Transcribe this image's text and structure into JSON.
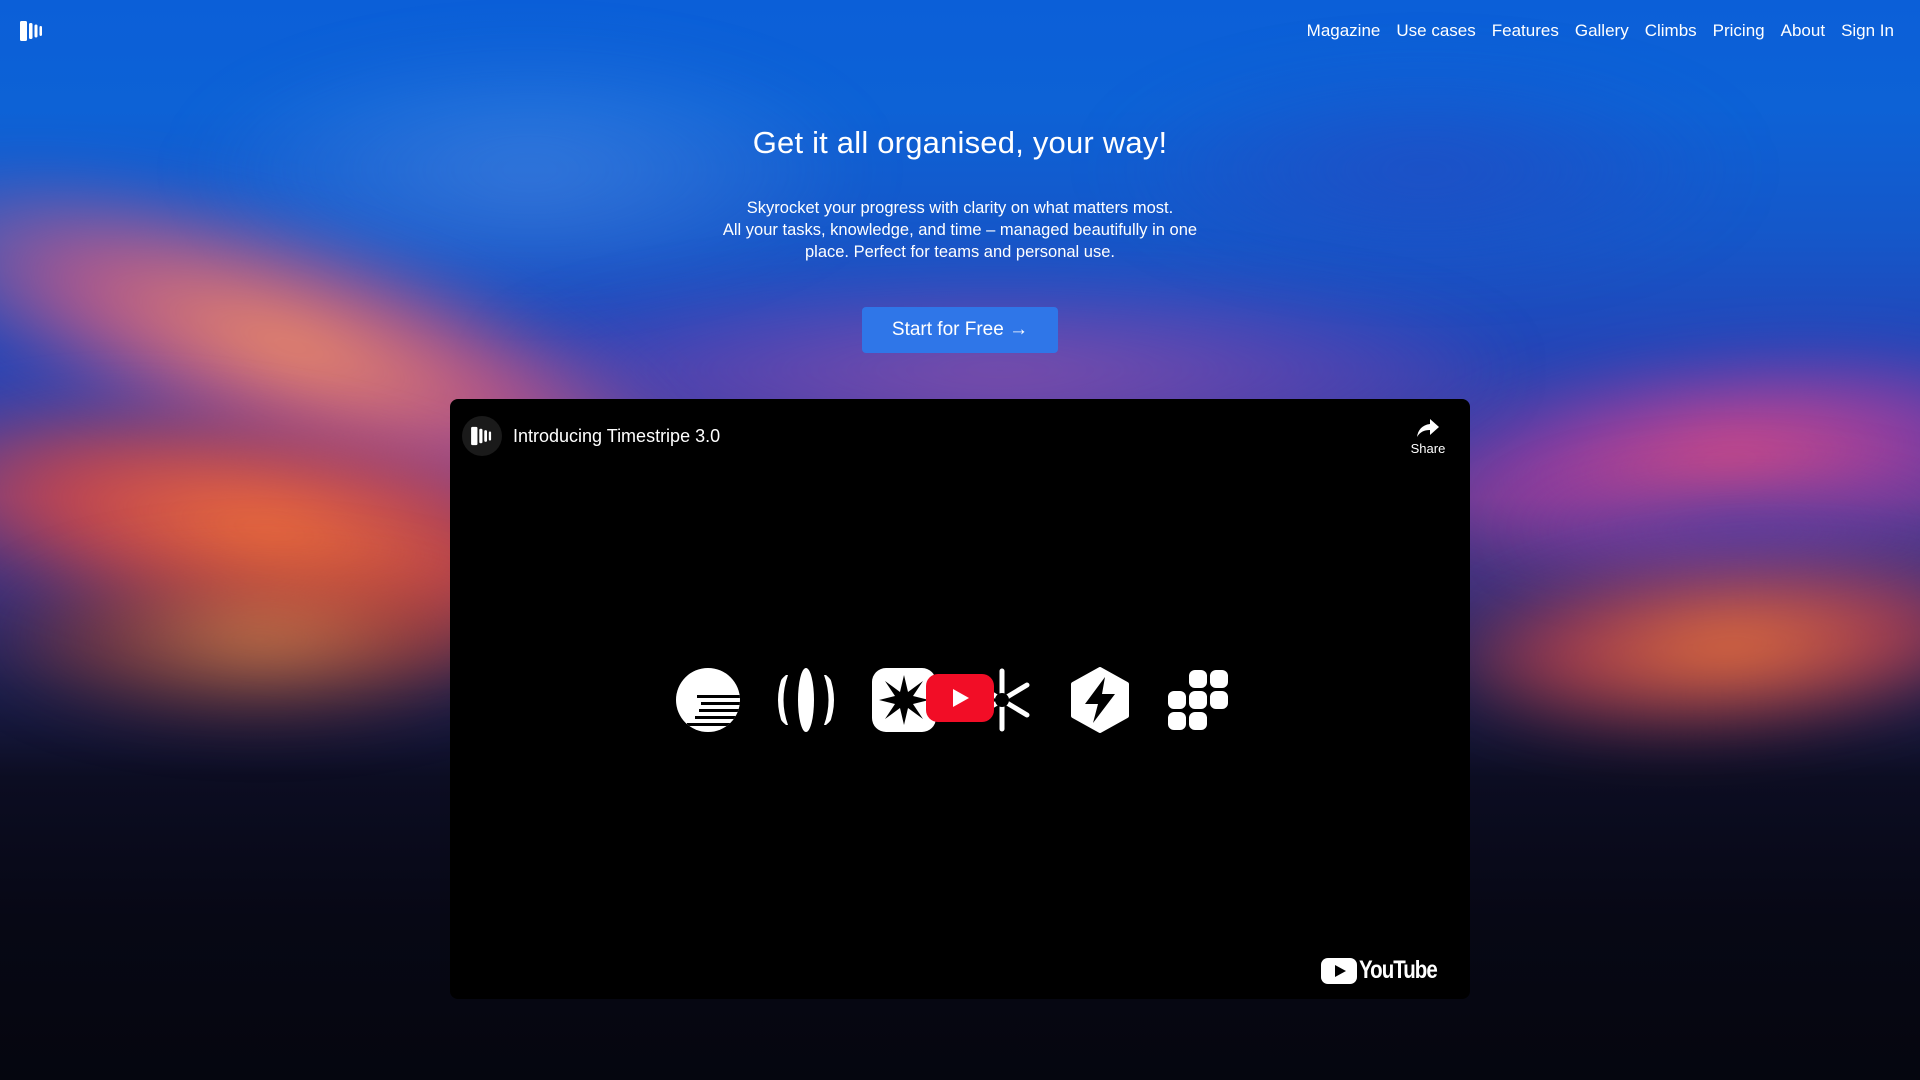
{
  "header": {
    "logo_icon": "timestripe-logo-icon",
    "nav": [
      {
        "label": "Magazine"
      },
      {
        "label": "Use cases"
      },
      {
        "label": "Features"
      },
      {
        "label": "Gallery"
      },
      {
        "label": "Climbs"
      },
      {
        "label": "Pricing"
      },
      {
        "label": "About"
      },
      {
        "label": "Sign In"
      }
    ]
  },
  "hero": {
    "title": "Get it all organised, your way!",
    "subtitle_line1": "Skyrocket your progress with clarity on what matters most.",
    "subtitle_line2": "All your tasks, knowledge, and time – managed beautifully in one place. Perfect for teams and personal use.",
    "cta_label": "Start for Free →",
    "cta_color": "#2f76e8"
  },
  "video": {
    "title": "Introducing Timestripe 3.0",
    "share_label": "Share",
    "youtube_label": "YouTube",
    "play_color": "#f20d26",
    "icons": [
      "sun-stripes-icon",
      "vertical-stripes-circle-icon",
      "starburst-icon",
      "snowflake-icon",
      "lightning-hexagon-icon",
      "grid-blocks-icon"
    ]
  }
}
